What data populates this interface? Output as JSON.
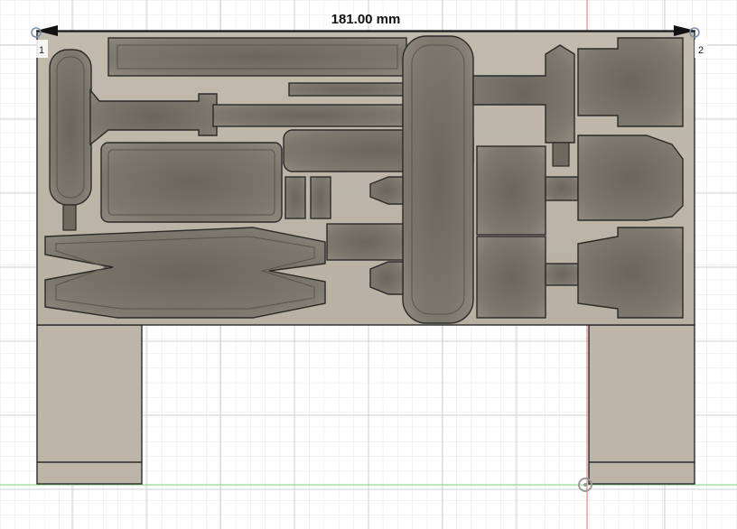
{
  "dimension": {
    "value": "181.00 mm"
  },
  "points": [
    {
      "label": "1"
    },
    {
      "label": "2"
    }
  ],
  "colors": {
    "background": "#ffffff",
    "grid_minor": "#e6e6e6",
    "grid_major": "#d2d2d2",
    "model_face": "#bdb6a8",
    "pocket_floor": "#77726a",
    "axis_red": "#e36a6a",
    "axis_green": "#7cd67c"
  }
}
